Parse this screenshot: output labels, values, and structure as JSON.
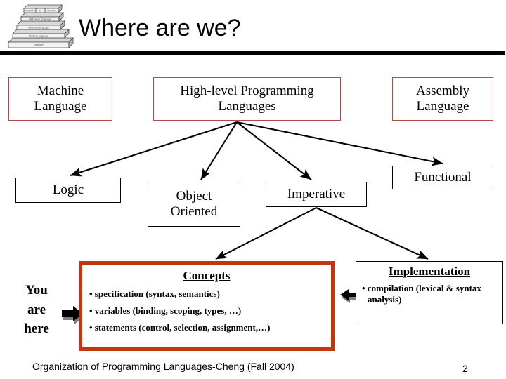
{
  "slide": {
    "title": "Where are we?",
    "footer": "Organization of Programming Languages-Cheng (Fall 2004)",
    "page_number": "2",
    "colors": {
      "title_rule": "#000000",
      "top_box_border": "#b34a4a",
      "concepts_border": "#c0360f",
      "plain_box_border": "#000000",
      "arrow": "#000000",
      "arrow_shadow": "#808080"
    }
  },
  "logo": {
    "name": "language-layers-stack-logo",
    "layers": [
      "FORTRAN   C   PASCAL",
      "High-level language",
      "Assembly language",
      "Machine language",
      "Hardware"
    ]
  },
  "row1": {
    "machine_language": "Machine\nLanguage",
    "high_level": "High-level Programming\nLanguages",
    "assembly_language": "Assembly\nLanguage"
  },
  "row2": {
    "logic": "Logic",
    "object_oriented": "Object\nOriented",
    "imperative": "Imperative",
    "functional": "Functional"
  },
  "concepts": {
    "heading": "Concepts",
    "bullets": [
      "• specification (syntax, semantics)",
      "• variables (binding, scoping, types, …)",
      "• statements (control, selection, assignment,…)"
    ]
  },
  "implementation": {
    "heading": "Implementation",
    "bullets": [
      "• compilation (lexical & syntax analysis)"
    ]
  },
  "you_are_here": {
    "line1": "You",
    "line2": "are",
    "line3": "here"
  }
}
